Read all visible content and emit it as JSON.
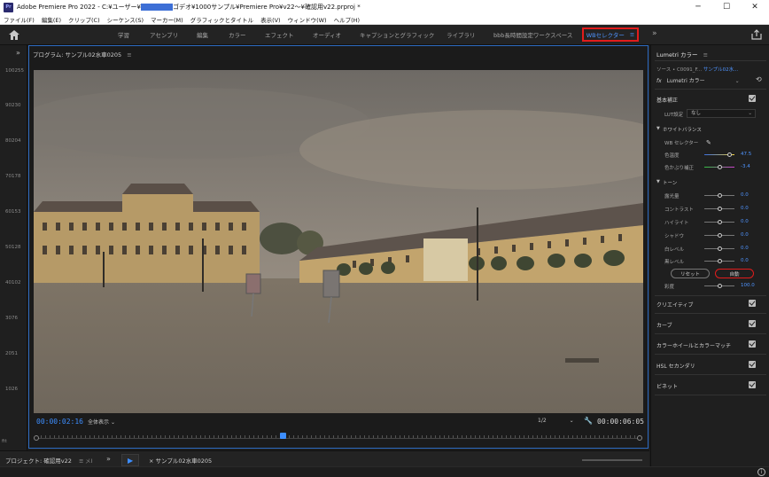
{
  "window": {
    "app_icon": "Pr",
    "title_prefix": "Adobe Premiere Pro 2022 - C:¥ユーザー¥",
    "title_suffix": "ゴデオ¥1000サンプル¥Premiere Pro¥v22～¥確認用v22.prproj *",
    "min": "─",
    "max": "☐",
    "close": "✕"
  },
  "menu": [
    "ファイル(F)",
    "編集(E)",
    "クリップ(C)",
    "シーケンス(S)",
    "マーカー(M)",
    "グラフィックとタイトル",
    "表示(V)",
    "ウィンドウ(W)",
    "ヘルプ(H)"
  ],
  "workspaces": {
    "tabs": [
      "学習",
      "アセンブリ",
      "編集",
      "カラー",
      "エフェクト",
      "オーディオ",
      "キャプションとグラフィック",
      "ライブラリ",
      "bbb長時間設定ワークスペース"
    ],
    "active": "WBセレクター",
    "burger": "≡",
    "more": "»"
  },
  "left_rail": {
    "arrow": "»",
    "ruler_labels": [
      "100255",
      "90230",
      "80204",
      "70178",
      "60153",
      "50128",
      "40102",
      "3076",
      "2051",
      "1026"
    ],
    "fit": "ﬁt"
  },
  "program": {
    "header": "プログラム: サンプル02水車0205",
    "burger": "≡",
    "timecode_current": "00:00:02:16",
    "fit": "全体表示",
    "resolution": "1/2",
    "timecode_duration": "00:00:06:05",
    "dropdown": "⌄",
    "wrench": "🔧"
  },
  "bottom": {
    "project_tab": "プロジェクト: 確認用v22",
    "burger": "≡",
    "close_tab": "メI",
    "more": "»",
    "play": "▶",
    "sequence_tab": "×  サンプル02水車0205",
    "info": "i"
  },
  "lumetri": {
    "title": "Lumetri カラー",
    "burger": "≡",
    "source": "ソース • C0091_F...",
    "sequence": "サンプル02水...",
    "fx_symbol": "fx",
    "fx_label": "Lumetri カラー",
    "dropdown": "⌄",
    "reset_icon": "⟲",
    "basic": "基本補正",
    "lut_label": "LUT設定",
    "lut_value": "なし",
    "white_balance": "ホワイトバランス",
    "wb_selector": "WB セレクター",
    "temperature": {
      "label": "色温度",
      "value": "47.5"
    },
    "tint": {
      "label": "色かぶり補正",
      "value": "-3.4"
    },
    "tone": "トーン",
    "tone_rows": [
      {
        "label": "露光量",
        "value": "0.0"
      },
      {
        "label": "コントラスト",
        "value": "0.0"
      },
      {
        "label": "ハイライト",
        "value": "0.0"
      },
      {
        "label": "シャドウ",
        "value": "0.0"
      },
      {
        "label": "白レベル",
        "value": "0.0"
      },
      {
        "label": "黒レベル",
        "value": "0.0"
      }
    ],
    "reset_button": "リセット",
    "auto_button": "自動",
    "saturation": {
      "label": "彩度",
      "value": "100.0"
    },
    "sections": [
      "クリエイティブ",
      "カーブ",
      "カラーホイールとカラーマッチ",
      "HSL セカンダリ",
      "ビネット"
    ],
    "colors": {
      "accent": "#4f94ff",
      "highlight_box": "#e11c1c"
    }
  }
}
